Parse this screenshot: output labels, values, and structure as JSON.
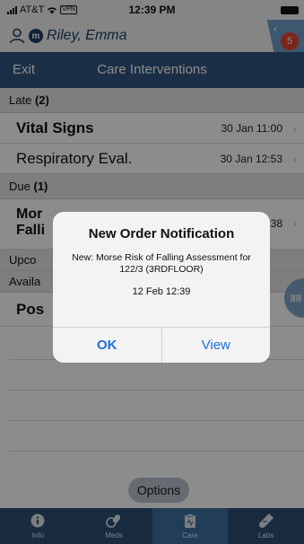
{
  "status_bar": {
    "carrier": "AT&T",
    "vpn": "VPN",
    "time": "12:39 PM"
  },
  "patient": {
    "name": "Riley, Emma",
    "badge_letter": "m",
    "notification_count": "5"
  },
  "header": {
    "exit_label": "Exit",
    "title": "Care Interventions"
  },
  "sections": {
    "late": {
      "label": "Late",
      "count": "(2)"
    },
    "due": {
      "label": "Due",
      "count": "(1)"
    },
    "upcoming": {
      "label": "Upco"
    },
    "available": {
      "label": "Availa"
    }
  },
  "rows": {
    "vital_signs": {
      "title": "Vital Signs",
      "time": "30 Jan 11:00"
    },
    "respiratory": {
      "title": "Respiratory Eval.",
      "time": "30 Jan 12:53"
    },
    "morse": {
      "title_line1": "Mor",
      "title_line2": "Falli",
      "time": "38"
    },
    "pos": {
      "title": "Pos"
    }
  },
  "dialog": {
    "title": "New Order Notification",
    "message": "New: Morse Risk of Falling Assessment for 122/3 (3RDFLOOR)",
    "timestamp": "12 Feb 12:39",
    "ok_label": "OK",
    "view_label": "View"
  },
  "options_label": "Options",
  "tabs": [
    {
      "label": "Info",
      "icon": "info-icon"
    },
    {
      "label": "Meds",
      "icon": "pills-icon"
    },
    {
      "label": "Care",
      "icon": "clipboard-icon",
      "active": true
    },
    {
      "label": "Labs",
      "icon": "test-tube-icon"
    }
  ],
  "colors": {
    "header": "#30557e",
    "tab_active": "#3f6f9f",
    "accent_blue": "#1e6fd9",
    "badge_red": "#e34234"
  }
}
